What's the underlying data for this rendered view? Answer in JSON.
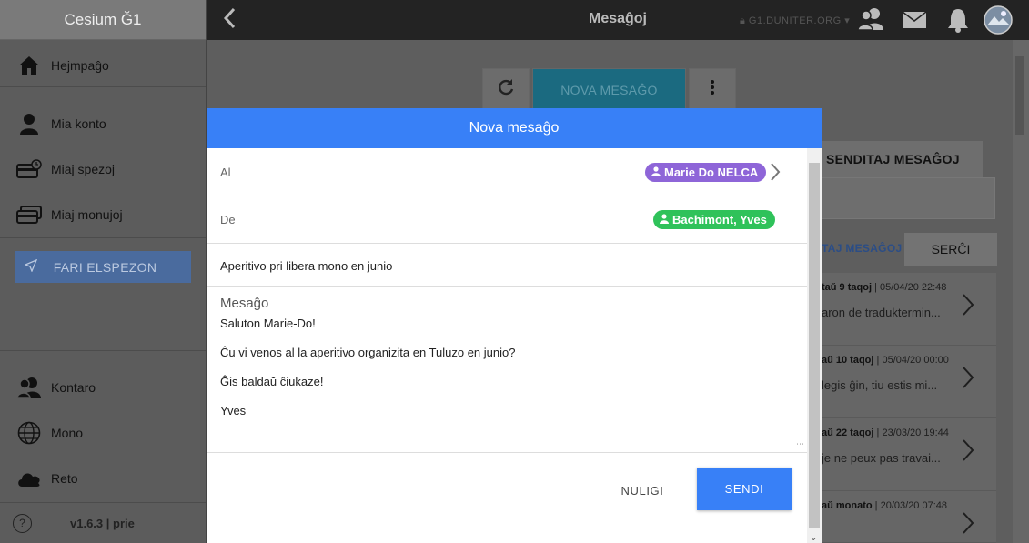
{
  "app": {
    "title": "Cesium Ğ1",
    "version": "v1.6.3 | prie"
  },
  "sidebar": {
    "items": [
      {
        "label": "Hejmpaĝo",
        "icon": "home-icon"
      },
      {
        "label": "Mia konto",
        "icon": "user-icon"
      },
      {
        "label": "Miaj spezoj",
        "icon": "wallet-history-icon"
      },
      {
        "label": "Miaj monujoj",
        "icon": "wallets-icon"
      }
    ],
    "transfer_button": "FARI ELSPEZON",
    "bottom_items": [
      {
        "label": "Kontaro",
        "icon": "people-icon"
      },
      {
        "label": "Mono",
        "icon": "globe-icon"
      },
      {
        "label": "Reto",
        "icon": "cloud-icon"
      }
    ],
    "help_icon": "help-icon"
  },
  "topbar": {
    "title": "Mesaĝoj",
    "node": "G1.DUNITER.ORG",
    "icons": [
      "back-icon",
      "people-icon",
      "mail-icon",
      "bell-icon",
      "avatar"
    ]
  },
  "toolbar": {
    "new_message": "NOVA MESAĜO"
  },
  "tabs": {
    "sent": "SENDITAJ MESAĜOJ",
    "mine": "TAJ MESAĜOJ"
  },
  "search_button": "SERĈI",
  "messages": [
    {
      "meta_bold": "taŭ 9 taqoj",
      "date": "05/04/20 22:48",
      "preview": "aron de traduktermin..."
    },
    {
      "meta_bold": "aŭ 10 taqoj",
      "date": "05/04/20 00:00",
      "preview": "legis ĝin, tiu estis mi..."
    },
    {
      "meta_bold": "aŭ 22 taqoj",
      "date": "23/03/20 19:44",
      "preview": "je ne peux pas travai..."
    },
    {
      "meta_bold": "aŭ monato",
      "date": "20/03/20 07:48",
      "preview": ""
    }
  ],
  "modal": {
    "title": "Nova mesaĝo",
    "to_label": "Al",
    "to_value": "Marie Do NELCA",
    "from_label": "De",
    "from_value": "Bachimont, Yves",
    "subject": "Aperitivo pri libera mono en junio",
    "body_label": "Mesaĝo",
    "body_lines": [
      "Saluton Marie-Do!",
      "Ĉu vi venos al la aperitivo organizita en Tuluzo en junio?",
      "Ĝis baldaŭ ĉiukaze!",
      "Yves"
    ],
    "cancel": "NULIGI",
    "send": "SENDI",
    "colors": {
      "header": "#3880f7",
      "to_chip": "#8e65d8",
      "from_chip": "#2fc25a"
    }
  }
}
